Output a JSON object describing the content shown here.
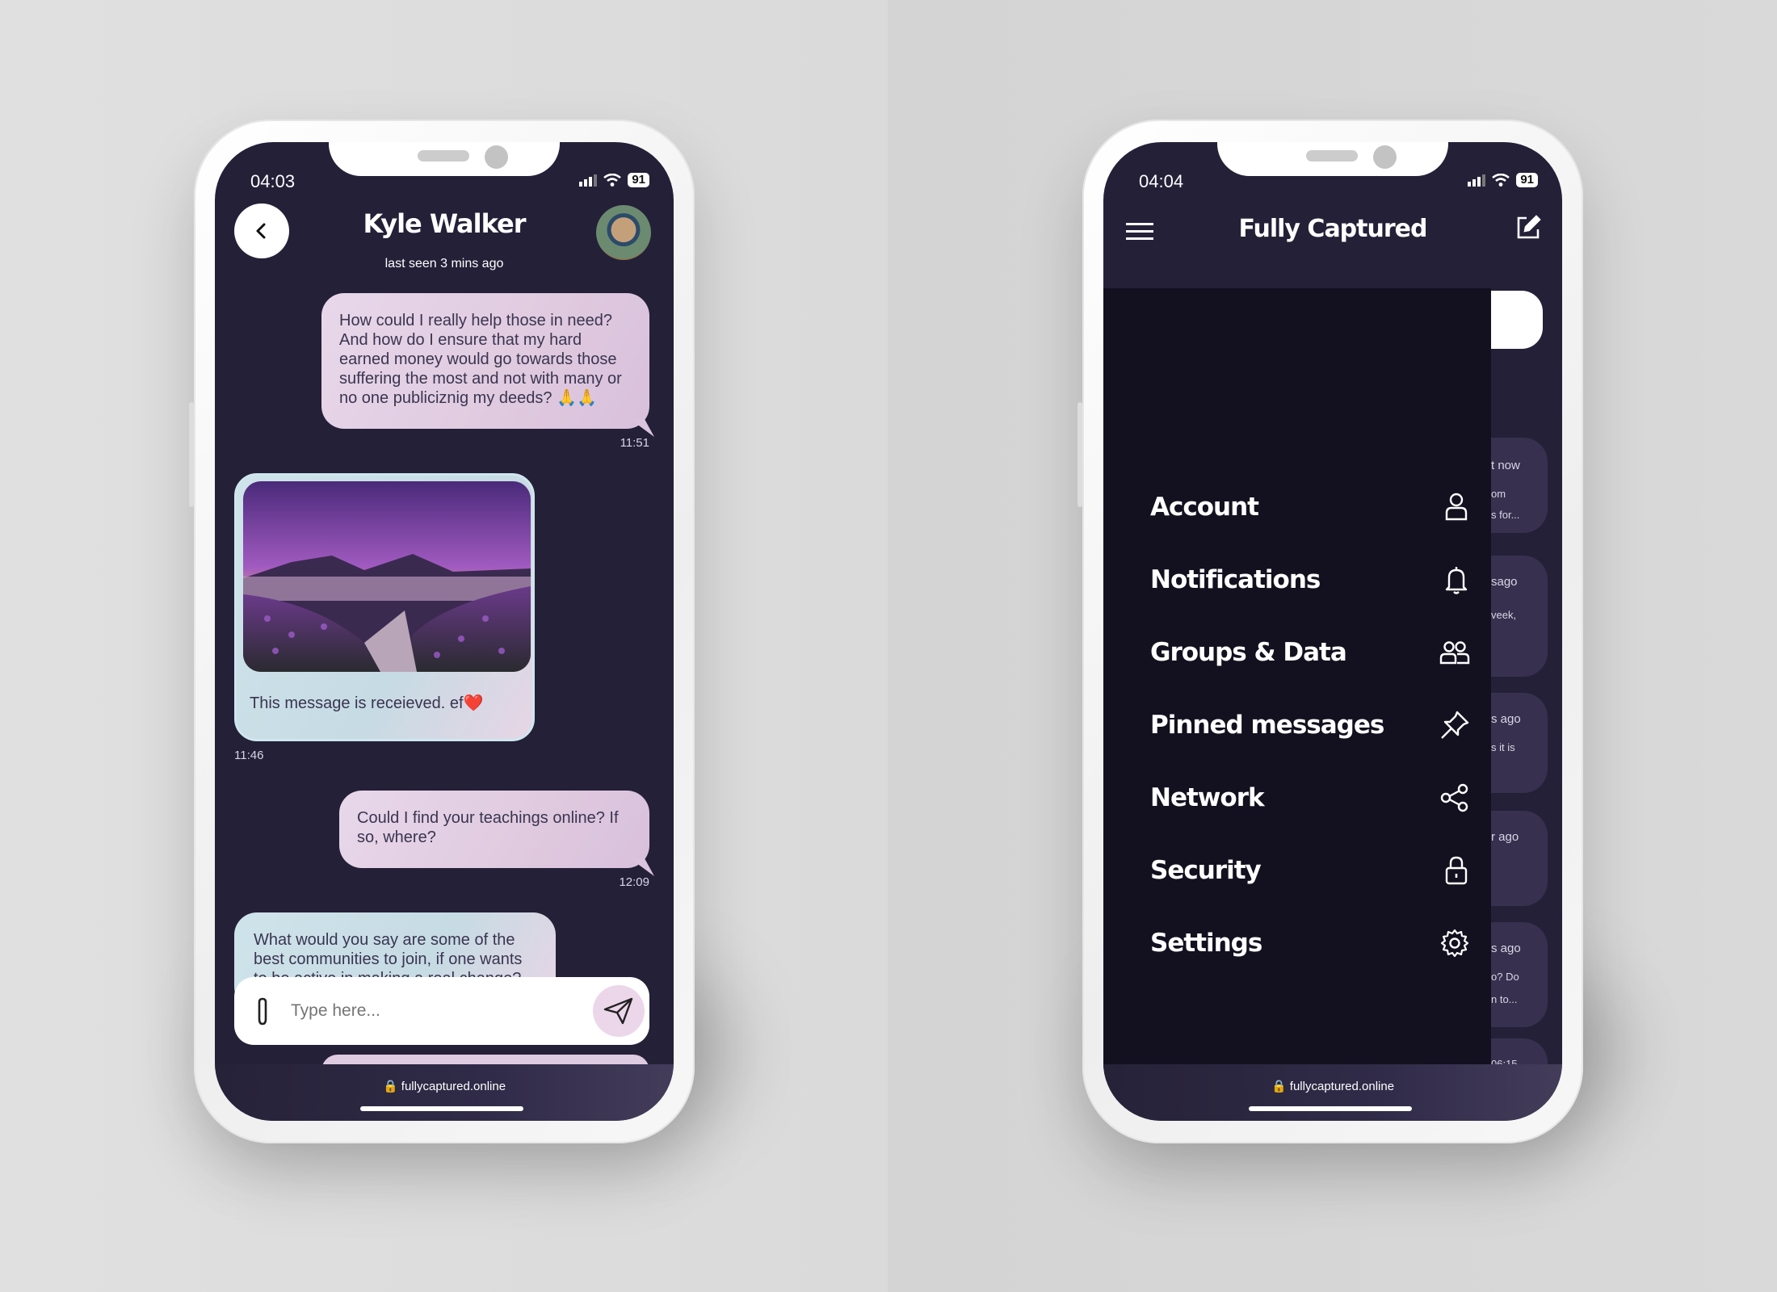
{
  "chat_screen": {
    "status": {
      "time": "04:03",
      "battery": "91"
    },
    "header": {
      "contact_name": "Kyle Walker",
      "last_seen": "last seen 3 mins ago"
    },
    "messages": [
      {
        "type": "outgoing",
        "text": "How could I really help those in need? And how do I ensure that my hard earned money would go towards those suffering the most and not with many or no one publiciznig my deeds? 🙏🙏",
        "time": "11:51"
      },
      {
        "type": "incoming-image",
        "text": "This message is receieved. ef❤️",
        "time": "11:46"
      },
      {
        "type": "outgoing",
        "text": "Could I find your teachings online? If so, where?",
        "time": "12:09"
      },
      {
        "type": "incoming",
        "text": "What would you say are some of the best communities to join, if one wants to be active in making a real change?"
      }
    ],
    "composer": {
      "placeholder": "Type here..."
    },
    "url": "fullycaptured.online"
  },
  "menu_screen": {
    "status": {
      "time": "04:04",
      "battery": "91"
    },
    "app_title": "Fully Captured",
    "menu_items": [
      {
        "label": "Account",
        "icon": "user-icon"
      },
      {
        "label": "Notifications",
        "icon": "bell-icon"
      },
      {
        "label": "Groups & Data",
        "icon": "group-icon"
      },
      {
        "label": "Pinned messages",
        "icon": "pin-icon"
      },
      {
        "label": "Network",
        "icon": "share-icon"
      },
      {
        "label": "Security",
        "icon": "lock-icon"
      },
      {
        "label": "Settings",
        "icon": "gear-icon"
      }
    ],
    "background_snippets": [
      "t now",
      "om",
      "s for...",
      "sago",
      "veek,",
      "s ago",
      "s it is",
      "r ago",
      "s ago",
      "o? Do",
      "n to...",
      "06:15"
    ],
    "url": "fullycaptured.online"
  },
  "colors": {
    "screen_bg": "#242038",
    "drawer_bg": "#13111f",
    "outgoing_bubble": "#e0cadf",
    "incoming_bubble": "#c6dbe4"
  }
}
